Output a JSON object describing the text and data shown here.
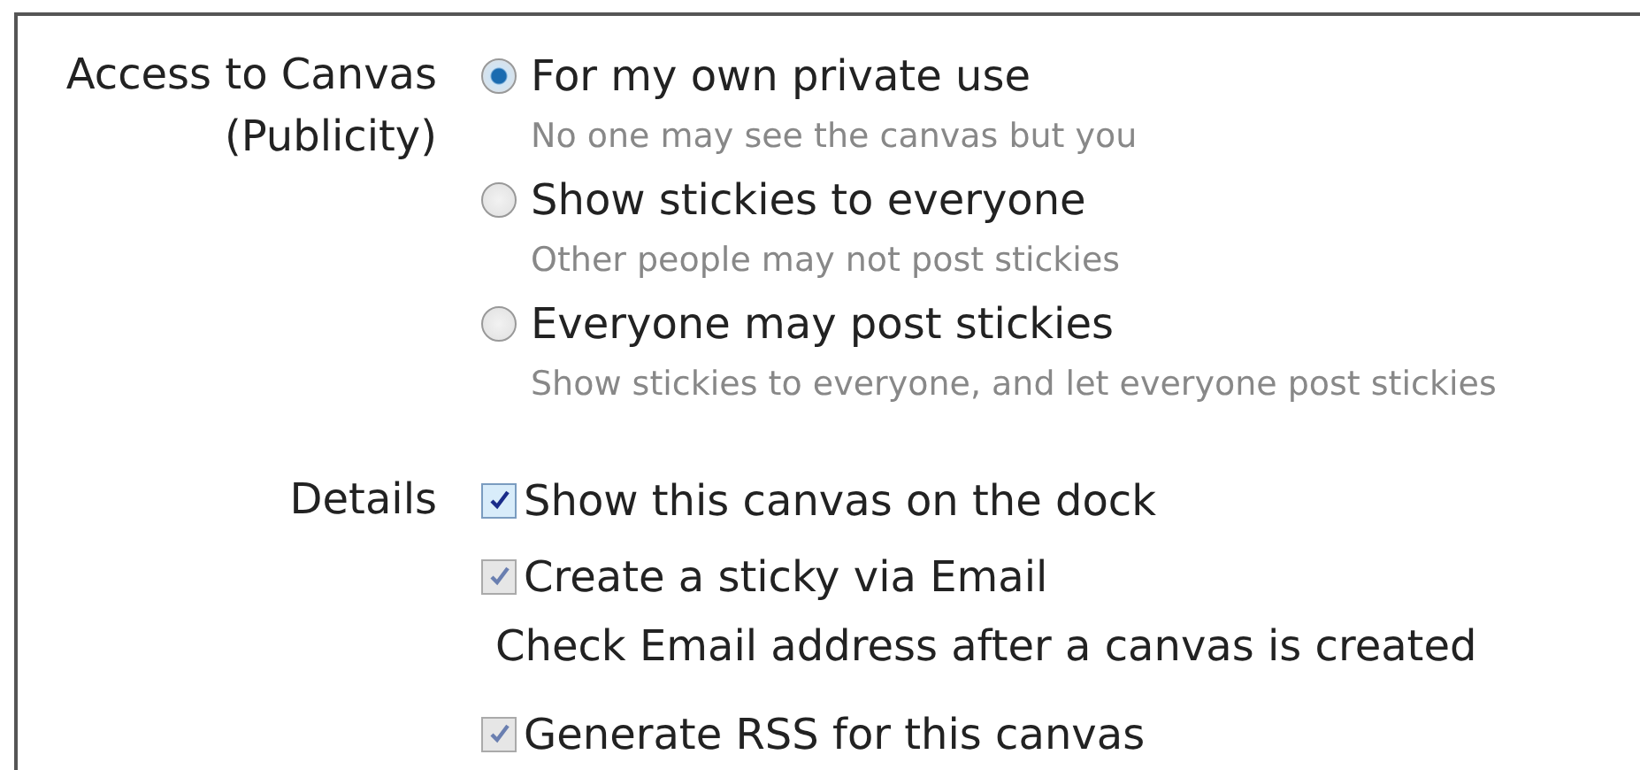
{
  "access": {
    "label": "Access to Canvas",
    "sublabel": "(Publicity)",
    "options": [
      {
        "label": "For my own private use",
        "description": "No one may see the canvas but you",
        "selected": true
      },
      {
        "label": "Show stickies to everyone",
        "description": "Other people may not post stickies",
        "selected": false
      },
      {
        "label": "Everyone may post stickies",
        "description": "Show stickies to everyone, and let everyone post stickies",
        "selected": false
      }
    ]
  },
  "details": {
    "label": "Details",
    "items": [
      {
        "kind": "checkbox",
        "label": "Show this canvas on the dock",
        "checked": true,
        "disabled": false
      },
      {
        "kind": "checkbox",
        "label": "Create a sticky via Email",
        "checked": true,
        "disabled": true
      },
      {
        "kind": "note",
        "label": "Check Email address after a canvas is created"
      },
      {
        "kind": "checkbox",
        "label": "Generate RSS for this canvas",
        "checked": true,
        "disabled": true
      }
    ]
  }
}
